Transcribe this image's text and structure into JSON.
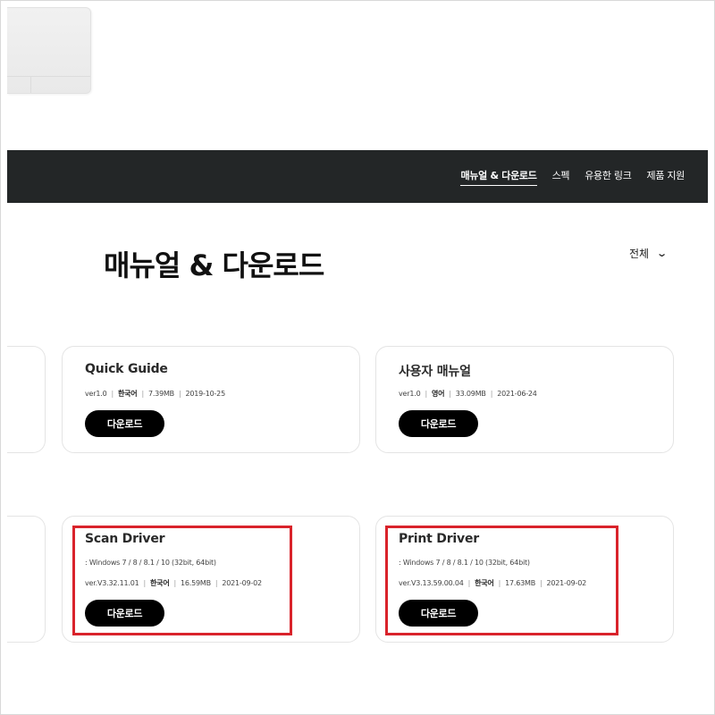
{
  "nav": {
    "items": [
      "매뉴얼 & 다운로드",
      "스펙",
      "유용한 링크",
      "제품 지원"
    ],
    "active_index": 0
  },
  "page_title": "매뉴얼 & 다운로드",
  "filter": {
    "label": "전체",
    "icon": "chevron-down-icon"
  },
  "download_label": "다운로드",
  "cards": [
    {
      "title": "Quick Guide",
      "version": "ver1.0",
      "language": "한국어",
      "size": "7.39MB",
      "date": "2019-10-25"
    },
    {
      "title": "사용자 매뉴얼",
      "version": "ver1.0",
      "language": "영어",
      "size": "33.09MB",
      "date": "2021-06-24"
    },
    {
      "title": "Scan Driver",
      "os": ": Windows 7 / 8 / 8.1 / 10 (32bit, 64bit)",
      "version": "ver.V3.32.11.01",
      "language": "한국어",
      "size": "16.59MB",
      "date": "2021-09-02"
    },
    {
      "title": "Print Driver",
      "os": ": Windows 7 / 8 / 8.1 / 10 (32bit, 64bit)",
      "version": "ver.V3.13.59.00.04",
      "language": "한국어",
      "size": "17.63MB",
      "date": "2021-09-02"
    }
  ],
  "colors": {
    "nav_background": "#232627",
    "button": "#000000",
    "highlight": "#d9232b"
  }
}
